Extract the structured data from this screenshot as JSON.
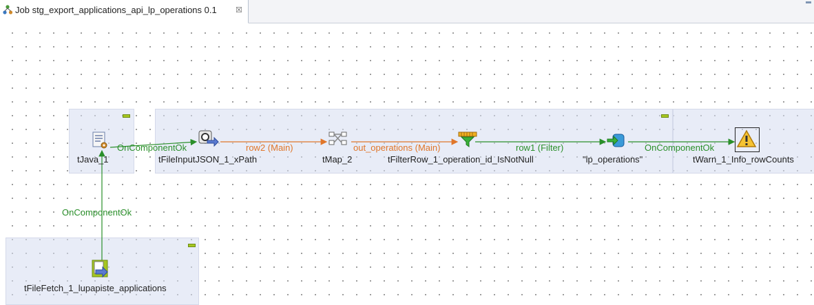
{
  "tab": {
    "title": "Job stg_export_applications_api_lp_operations 0.1",
    "close_symbol": "☒"
  },
  "components": {
    "tjava": "tJava_1",
    "tfileinputjson": "tFileInputJSON_1_xPath",
    "tmap": "tMap_2",
    "tfilterrow": "tFilterRow_1_operation_id_IsNotNull",
    "lp_operations": "\"lp_operations\"",
    "twarn": "tWarn_1_Info_rowCounts",
    "tfilefetch": "tFileFetch_1_lupapiste_applications"
  },
  "connections": {
    "oncomponentok_1": "OnComponentOk",
    "row2": "row2 (Main)",
    "out_operations": "out_operations (Main)",
    "row1": "row1 (Filter)",
    "oncomponentok_2": "OnComponentOk",
    "oncomponentok_3": "OnComponentOk"
  },
  "colors": {
    "trigger": "#2a8f2a",
    "main": "#e0762a",
    "subjob_bg": "#dde2f2",
    "subjob_min": "#a6c61f"
  }
}
